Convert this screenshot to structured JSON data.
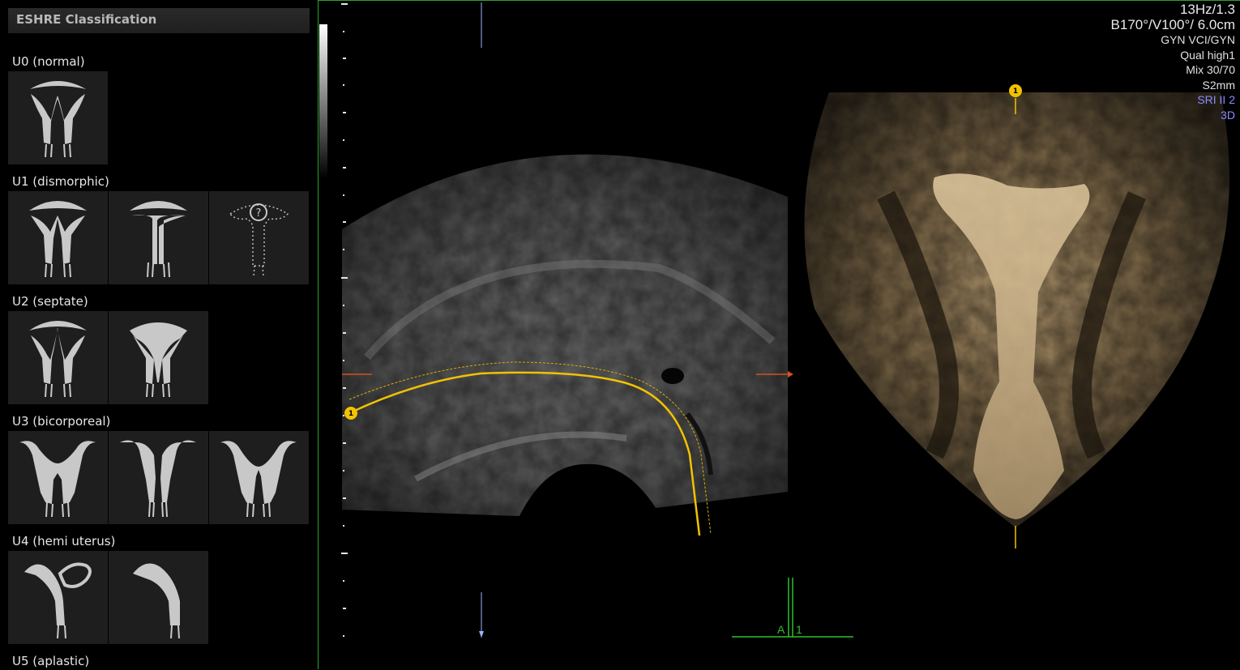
{
  "panel": {
    "title": "ESHRE Classification",
    "categories": [
      {
        "label": "U0 (normal)"
      },
      {
        "label": "U1 (dismorphic)"
      },
      {
        "label": "U2 (septate)"
      },
      {
        "label": "U3 (bicorporeal)"
      },
      {
        "label": "U4 (hemi uterus)"
      },
      {
        "label": "U5 (aplastic)"
      }
    ]
  },
  "params": {
    "line1": "13Hz/1.3",
    "line2": "B170°/V100°/ 6.0cm",
    "line3": "GYN VCI/GYN",
    "line4": "Qual high1",
    "line5": "Mix 30/70",
    "line6": "S2mm",
    "line7": "SRI II 2",
    "line8": "3D"
  },
  "markers": {
    "curve_marker": "1",
    "render_marker": "1",
    "axis_a": "A",
    "axis_num": "1"
  },
  "colors": {
    "curve": "#f2c200",
    "frame": "#2aa52a",
    "blue_text": "#8c8cff"
  }
}
